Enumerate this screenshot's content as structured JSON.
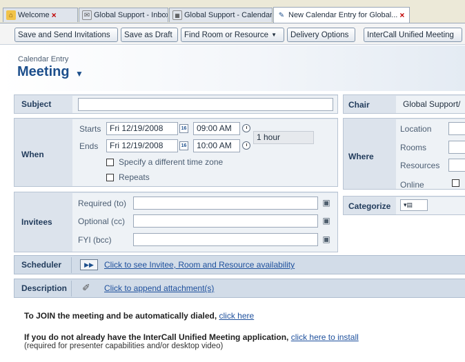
{
  "tabs": [
    {
      "label": "Welcome",
      "icon": "home-icon",
      "close": "×"
    },
    {
      "label": "Global Support - Inbox",
      "icon": "inbox-icon",
      "close": "×"
    },
    {
      "label": "Global Support - Calendar",
      "icon": "calendar-icon",
      "close": "×"
    },
    {
      "label": "New Calendar Entry for Global...",
      "icon": "new-entry-icon",
      "close": "×"
    }
  ],
  "toolbar": {
    "save_send": "Save and Send Invitations",
    "save_draft": "Save as Draft",
    "find_room": "Find Room or Resource",
    "delivery": "Delivery Options",
    "intercall": "InterCall Unified Meeting"
  },
  "header": {
    "entry_type": "Calendar Entry",
    "title": "Meeting"
  },
  "subject": {
    "label": "Subject",
    "value": ""
  },
  "when": {
    "label": "When",
    "starts_label": "Starts",
    "ends_label": "Ends",
    "start_date": "Fri 12/19/2008",
    "start_time": "09:00 AM",
    "end_date": "Fri 12/19/2008",
    "end_time": "10:00 AM",
    "duration": "1 hour",
    "timezone_label": "Specify a different time zone",
    "repeats_label": "Repeats",
    "cal_icon_text": "16"
  },
  "invitees": {
    "label": "Invitees",
    "required_label": "Required (to)",
    "optional_label": "Optional (cc)",
    "fyi_label": "FYI (bcc)"
  },
  "chair": {
    "label": "Chair",
    "value": "Global Support/"
  },
  "where": {
    "label": "Where",
    "location_label": "Location",
    "rooms_label": "Rooms",
    "resources_label": "Resources",
    "online_label": "Online"
  },
  "categorize": {
    "label": "Categorize"
  },
  "scheduler": {
    "label": "Scheduler",
    "link": "Click to see Invitee, Room and Resource availability"
  },
  "description": {
    "label": "Description",
    "link": "Click to append attachment(s)"
  },
  "body": {
    "line1_text": "To JOIN the meeting and be automatically dialed,",
    "line1_link": "click here",
    "line2_text": "If you do not already have the InterCall Unified Meeting application,",
    "line2_link": "click here to install",
    "line3_text": "(required for presenter capabilities and/or desktop video)"
  }
}
